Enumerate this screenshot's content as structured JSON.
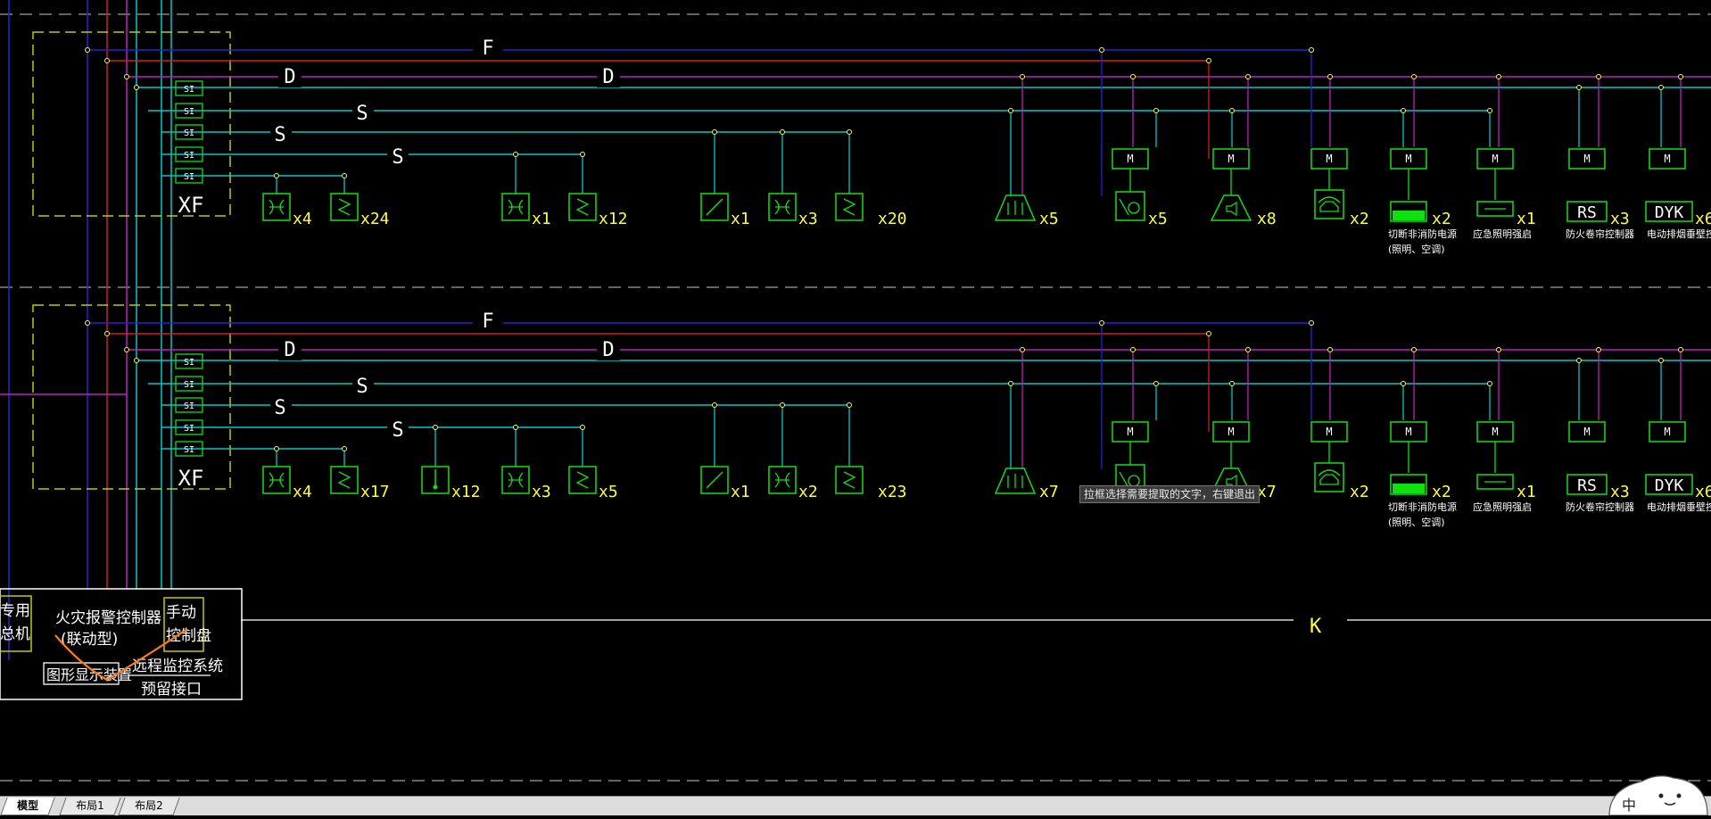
{
  "drawing": {
    "bus_labels": {
      "f": "F",
      "d": "D",
      "s": "S",
      "k": "K",
      "xf": "XF"
    },
    "si_label": "SI",
    "module_label": "M",
    "row1": {
      "device_counts": [
        "x4",
        "x24",
        "x1",
        "x12",
        "x1",
        "x3",
        "x20",
        "x5",
        "x5",
        "x8",
        "x2",
        "x2",
        "x1",
        "x3",
        "x6"
      ],
      "captions": [
        "切断非消防电源",
        "(照明、空调)",
        "应急照明强启",
        "防火卷帘控制器",
        "电动排烟垂壁控"
      ]
    },
    "row2": {
      "device_counts": [
        "x4",
        "x17",
        "x12",
        "x3",
        "x5",
        "x1",
        "x2",
        "x23",
        "x7",
        "x7",
        "x2",
        "x2",
        "x1",
        "x3",
        "x6"
      ],
      "captions": [
        "切断非消防电源",
        "(照明、空调)",
        "应急照明强启",
        "防火卷帘控制器",
        "电动排烟垂壁控"
      ]
    },
    "box_labels": {
      "rs": "RS",
      "dyk": "DYK"
    },
    "panel": {
      "dedicated_phone": [
        "专用",
        "总机"
      ],
      "fire_alarm_controller": "火灾报警控制器",
      "linkage_type": "(联动型)",
      "manual_panel": [
        "手动",
        "控制盘"
      ],
      "graphic_display": "图形显示装置",
      "remote_monitor": "远程监控系统",
      "reserved_port": "预留接口"
    }
  },
  "tooltip": "拉框选择需要提取的文字，右键退出",
  "tabs": [
    {
      "label": "模型",
      "active": true
    },
    {
      "label": "布局1",
      "active": false
    },
    {
      "label": "布局2",
      "active": false
    }
  ],
  "mascot_glyph": "中",
  "colors": {
    "background": "#000000",
    "bus_f": "#2424d6",
    "bus_d": "#c020c0",
    "bus_s": "#00c8c8",
    "power": "#d02020",
    "device": "#10e010",
    "label": "#ffff40",
    "frame": "#c8c800",
    "white": "#ffffff"
  }
}
